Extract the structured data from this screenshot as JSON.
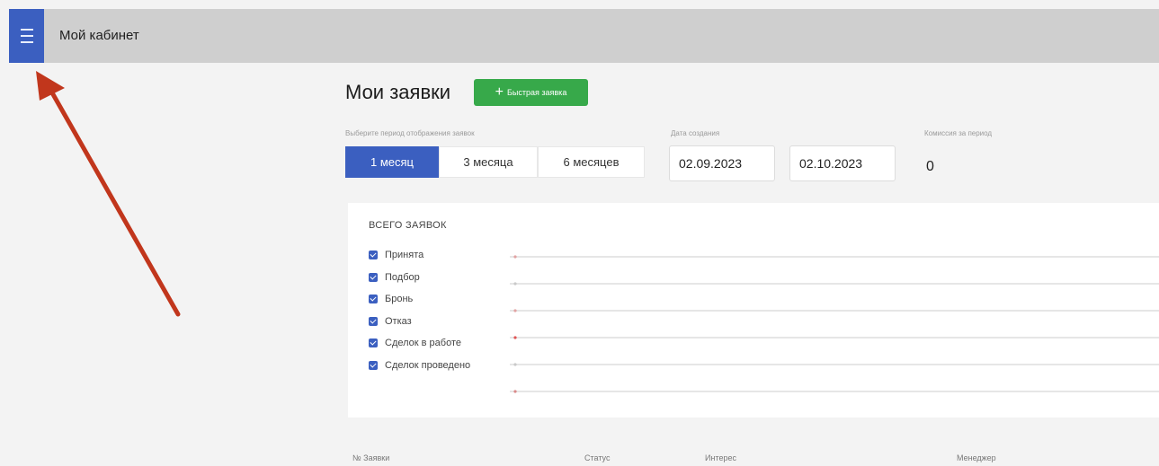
{
  "app": {
    "title": "Мой кабинет",
    "menu_icon": "hamburger-icon"
  },
  "page": {
    "title": "Мои заявки",
    "quick_button": "Быстрая заявка",
    "period_label": "Выберите период отображения заявок",
    "periods": [
      {
        "label": "1 месяц",
        "active": true
      },
      {
        "label": "3 месяца",
        "active": false
      },
      {
        "label": "6 месяцев",
        "active": false
      }
    ],
    "date_label": "Дата создания",
    "date_from": "02.09.2023",
    "date_to": "02.10.2023",
    "commission_label": "Комиссия за период",
    "commission_value": "0"
  },
  "chart": {
    "title": "ВСЕГО ЗАЯВОК",
    "legend": [
      {
        "label": "Принята",
        "checked": true
      },
      {
        "label": "Подбор",
        "checked": true
      },
      {
        "label": "Бронь",
        "checked": true
      },
      {
        "label": "Отказ",
        "checked": true
      },
      {
        "label": "Сделок в работе",
        "checked": true
      },
      {
        "label": "Сделок проведено",
        "checked": true
      }
    ]
  },
  "chart_data": {
    "type": "line",
    "title": "ВСЕГО ЗАЯВОК",
    "series": [
      {
        "name": "Принята",
        "values": [
          0
        ]
      },
      {
        "name": "Подбор",
        "values": [
          0
        ]
      },
      {
        "name": "Бронь",
        "values": [
          0
        ]
      },
      {
        "name": "Отказ",
        "values": [
          0
        ]
      },
      {
        "name": "Сделок в работе",
        "values": [
          0
        ]
      },
      {
        "name": "Сделок проведено",
        "values": [
          0
        ]
      }
    ],
    "colors": [
      "#e2a3a3",
      "#c9c9c9",
      "#e2a3a3",
      "#e05555",
      "#c9c9c9",
      "#d98a8a"
    ]
  },
  "table": {
    "headers": [
      "№ Заявки",
      "Статус",
      "Интерес",
      "Менеджер"
    ]
  },
  "colors": {
    "accent": "#3b5fc0",
    "success": "#37a94a",
    "annotation": "#c1361c"
  }
}
